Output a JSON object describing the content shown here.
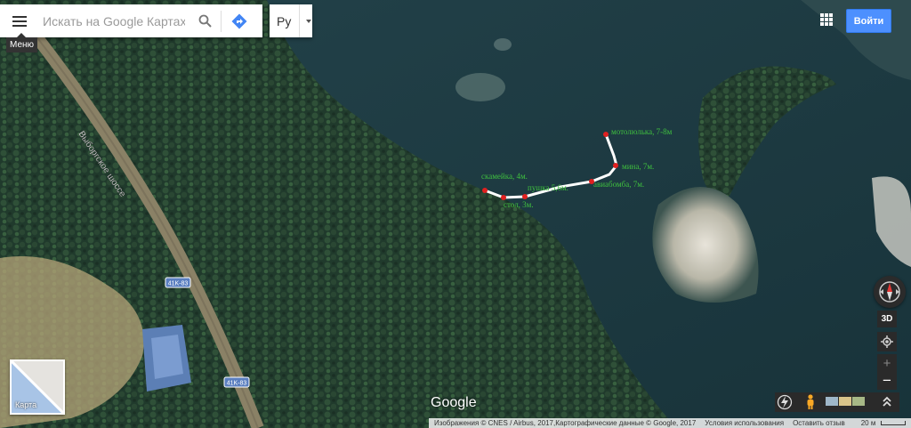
{
  "search": {
    "placeholder": "Искать на Google Картах"
  },
  "menu": {
    "tooltip": "Меню"
  },
  "language": {
    "label": "Ру"
  },
  "header": {
    "signin_label": "Войти"
  },
  "map": {
    "road_name": "Выборгское шоссе",
    "road_shields": [
      "41K-83",
      "41K-83"
    ],
    "markers": [
      {
        "label": "скамейка, 4м."
      },
      {
        "label": "стол, 3м."
      },
      {
        "label": "пушка 5,6м."
      },
      {
        "label": "авиабомба, 7м."
      },
      {
        "label": "мина, 7м."
      },
      {
        "label": "мотолюлька, 7-8м"
      }
    ],
    "annotation_color": "#3fbf3f",
    "marker_color": "#e02020"
  },
  "mapcard": {
    "label": "Карта"
  },
  "logo": {
    "text": "Google"
  },
  "controls": {
    "btn3d": "3D",
    "zoom_in": "+",
    "zoom_out": "−"
  },
  "footer": {
    "imagery": "Изображения © CNES / Airbus, 2017,Картографические данные © Google, 2017",
    "terms": "Условия использования",
    "feedback": "Оставить отзыв",
    "scale": "20 м"
  }
}
